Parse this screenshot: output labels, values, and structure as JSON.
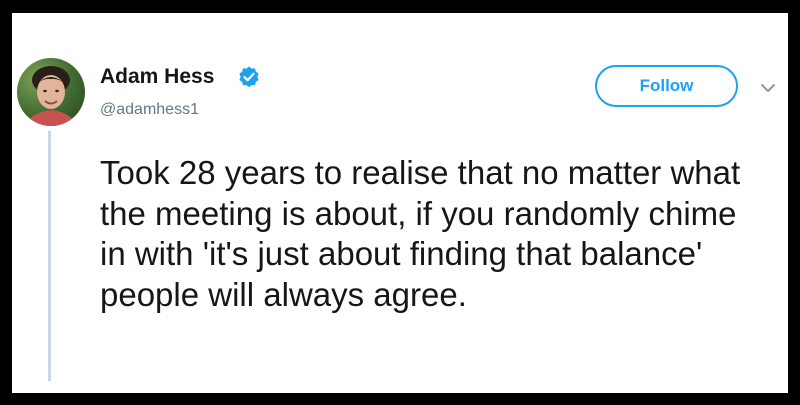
{
  "tweet": {
    "author_name": "Adam Hess",
    "author_handle": "@adamhess1",
    "follow_label": "Follow",
    "text": "Took 28 years to realise that no matter what the meeting is about, if you randomly chime in with 'it's just about finding that balance' people will always agree."
  },
  "icons": {
    "verified": "verified-badge-icon",
    "menu": "chevron-down-icon"
  },
  "colors": {
    "accent": "#1da1f2",
    "text": "#14171a",
    "muted": "#657786",
    "thread_line": "#c9d8e6",
    "background": "#ffffff",
    "border": "#000000"
  }
}
